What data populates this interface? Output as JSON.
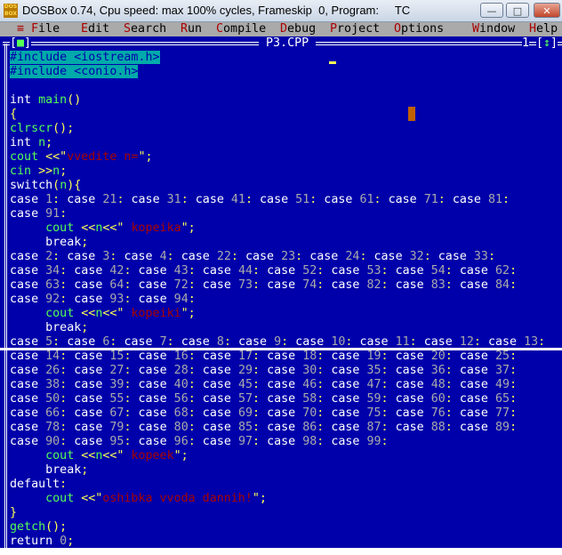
{
  "window": {
    "title": "DOSBox 0.74, Cpu speed: max 100% cycles, Frameskip  0, Program:     TC",
    "icon": "DOS\nBOX",
    "buttons": {
      "minimize": "—",
      "maximize": "□",
      "close": "✕"
    }
  },
  "menu": {
    "system": "≡",
    "items": [
      {
        "hk": "F",
        "rest": "ile",
        "col": 4
      },
      {
        "hk": "E",
        "rest": "dit",
        "col": 11
      },
      {
        "hk": "S",
        "rest": "earch",
        "col": 17
      },
      {
        "hk": "R",
        "rest": "un",
        "col": 25
      },
      {
        "hk": "C",
        "rest": "ompile",
        "col": 30
      },
      {
        "hk": "D",
        "rest": "ebug",
        "col": 39
      },
      {
        "hk": "P",
        "rest": "roject",
        "col": 46
      },
      {
        "hk": "O",
        "rest": "ptions",
        "col": 55
      },
      {
        "hk": "W",
        "rest": "indow",
        "col": 66
      },
      {
        "hk": "H",
        "rest": "elp",
        "col": 74
      }
    ]
  },
  "editor": {
    "filename": "P3.CPP",
    "window_number": "1",
    "close_box": "■",
    "zoom_box": "↕",
    "colors": {
      "background": "#0000aa",
      "keyword": "#ffffff",
      "identifier": "#55ff55",
      "symbol": "#ffff55",
      "number": "#aaaaaa",
      "string": "#aa0000",
      "selection": "#00aaaa"
    },
    "lines": [
      [
        [
          "#include <iostream.h>",
          "hl"
        ]
      ],
      [
        [
          "#include <conio.h>",
          "hl"
        ]
      ],
      [],
      [
        [
          "int ",
          "w"
        ],
        [
          "main",
          "f"
        ],
        [
          "()",
          "y"
        ]
      ],
      [
        [
          "{",
          "y"
        ]
      ],
      [
        [
          "clrscr",
          "f"
        ],
        [
          "();",
          "y"
        ]
      ],
      [
        [
          "int ",
          "w"
        ],
        [
          "n",
          "f"
        ],
        [
          ";",
          "y"
        ]
      ],
      [
        [
          "cout ",
          "f"
        ],
        [
          "<<\"",
          "y"
        ],
        [
          "vvedite n=",
          "s"
        ],
        [
          "\";",
          "y"
        ]
      ],
      [
        [
          "cin ",
          "f"
        ],
        [
          ">>",
          "y"
        ],
        [
          "n",
          "f"
        ],
        [
          ";",
          "y"
        ]
      ],
      [
        [
          "switch",
          "w"
        ],
        [
          "(",
          "y"
        ],
        [
          "n",
          "f"
        ],
        [
          "){",
          "y"
        ]
      ],
      [
        "CASES",
        1,
        21,
        31,
        41,
        51,
        61,
        71,
        81
      ],
      [
        "CASES",
        91
      ],
      [
        [
          "     cout ",
          "f"
        ],
        [
          "<<",
          "y"
        ],
        [
          "n",
          "f"
        ],
        [
          "<<\"",
          "y"
        ],
        [
          " kopeika",
          "s"
        ],
        [
          "\";",
          "y"
        ]
      ],
      [
        [
          "     break",
          "w"
        ],
        [
          ";",
          "y"
        ]
      ],
      [
        "CASES",
        2,
        3,
        4,
        22,
        23,
        24,
        32,
        33
      ],
      [
        "CASES",
        34,
        42,
        43,
        44,
        52,
        53,
        54,
        62
      ],
      [
        "CASES",
        63,
        64,
        72,
        73,
        74,
        82,
        83,
        84
      ],
      [
        "CASES",
        92,
        93,
        94
      ],
      [
        [
          "     cout ",
          "f"
        ],
        [
          "<<",
          "y"
        ],
        [
          "n",
          "f"
        ],
        [
          "<<\"",
          "y"
        ],
        [
          " kopeiki",
          "s"
        ],
        [
          "\";",
          "y"
        ]
      ],
      [
        [
          "     break",
          "w"
        ],
        [
          ";",
          "y"
        ]
      ],
      [
        "CASES",
        5,
        6,
        7,
        8,
        9,
        10,
        11,
        12,
        13
      ],
      [
        "CASES",
        14,
        15,
        16,
        17,
        18,
        19,
        20,
        25
      ],
      [
        "CASES",
        26,
        27,
        28,
        29,
        30,
        35,
        36,
        37
      ],
      [
        "CASES",
        38,
        39,
        40,
        45,
        46,
        47,
        48,
        49
      ],
      [
        "CASES",
        50,
        55,
        56,
        57,
        58,
        59,
        60,
        65
      ],
      [
        "CASES",
        66,
        67,
        68,
        69,
        70,
        75,
        76,
        77
      ],
      [
        "CASES",
        78,
        79,
        80,
        85,
        86,
        87,
        88,
        89
      ],
      [
        "CASES",
        90,
        95,
        96,
        97,
        98,
        99
      ],
      [
        [
          "     cout ",
          "f"
        ],
        [
          "<<",
          "y"
        ],
        [
          "n",
          "f"
        ],
        [
          "<<\"",
          "y"
        ],
        [
          " kopeek",
          "s"
        ],
        [
          "\";",
          "y"
        ]
      ],
      [
        [
          "     break",
          "w"
        ],
        [
          ";",
          "y"
        ]
      ],
      [
        [
          "default",
          "w"
        ],
        [
          ":",
          "y"
        ]
      ],
      [
        [
          "     cout ",
          "f"
        ],
        [
          "<<\"",
          "y"
        ],
        [
          "oshibka vvoda dannih!",
          "s"
        ],
        [
          "\";",
          "y"
        ]
      ],
      [
        [
          "}",
          "y"
        ]
      ],
      [
        [
          "getch",
          "f"
        ],
        [
          "();",
          "y"
        ]
      ],
      [
        [
          "return ",
          "w"
        ],
        [
          "0",
          "n"
        ],
        [
          ";",
          "y"
        ]
      ]
    ],
    "case_keyword": "case"
  }
}
